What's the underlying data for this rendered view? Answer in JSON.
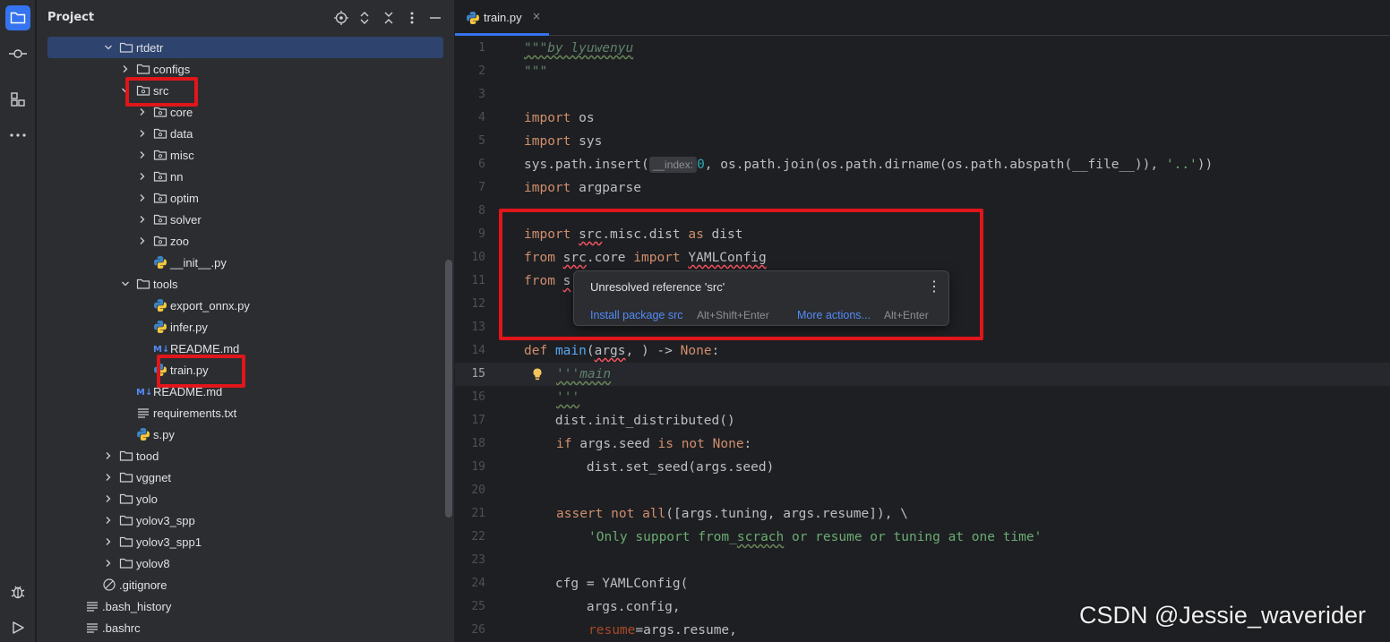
{
  "activity_bar": {
    "icons": [
      "folder-icon",
      "commit-icon",
      "structure-icon",
      "more-icon",
      "debug-icon",
      "run-icon"
    ]
  },
  "project_panel": {
    "title": "Project",
    "header_icons": [
      "locate-icon",
      "expand-all-icon",
      "collapse-all-icon",
      "options-icon",
      "hide-icon"
    ],
    "tree": [
      {
        "label": "rtdetr",
        "type": "folder",
        "expanded": true,
        "selected": true
      },
      {
        "label": "configs",
        "type": "folder",
        "expanded": false
      },
      {
        "label": "src",
        "type": "package",
        "expanded": true
      },
      {
        "label": "core",
        "type": "package",
        "expanded": false
      },
      {
        "label": "data",
        "type": "package",
        "expanded": false
      },
      {
        "label": "misc",
        "type": "package",
        "expanded": false
      },
      {
        "label": "nn",
        "type": "package",
        "expanded": false
      },
      {
        "label": "optim",
        "type": "package",
        "expanded": false
      },
      {
        "label": "solver",
        "type": "package",
        "expanded": false
      },
      {
        "label": "zoo",
        "type": "package",
        "expanded": false
      },
      {
        "label": "__init__.py",
        "type": "python"
      },
      {
        "label": "tools",
        "type": "folder",
        "expanded": true
      },
      {
        "label": "export_onnx.py",
        "type": "python"
      },
      {
        "label": "infer.py",
        "type": "python"
      },
      {
        "label": "README.md",
        "type": "markdown"
      },
      {
        "label": "train.py",
        "type": "python"
      },
      {
        "label": "README.md",
        "type": "markdown"
      },
      {
        "label": "requirements.txt",
        "type": "text"
      },
      {
        "label": "s.py",
        "type": "python"
      },
      {
        "label": "tood",
        "type": "folder",
        "expanded": false
      },
      {
        "label": "vggnet",
        "type": "folder",
        "expanded": false
      },
      {
        "label": "yolo",
        "type": "folder",
        "expanded": false
      },
      {
        "label": "yolov3_spp",
        "type": "folder",
        "expanded": false
      },
      {
        "label": "yolov3_spp1",
        "type": "folder",
        "expanded": false
      },
      {
        "label": "yolov8",
        "type": "folder",
        "expanded": false
      },
      {
        "label": ".gitignore",
        "type": "ignore"
      },
      {
        "label": ".bash_history",
        "type": "text"
      },
      {
        "label": ".bashrc",
        "type": "text"
      }
    ]
  },
  "editor": {
    "tab": {
      "label": "train.py",
      "close": "×"
    },
    "line_numbers": [
      "1",
      "2",
      "3",
      "4",
      "5",
      "6",
      "7",
      "8",
      "9",
      "10",
      "11",
      "12",
      "13",
      "14",
      "15",
      "16",
      "17",
      "18",
      "19",
      "20",
      "21",
      "22",
      "23",
      "24",
      "25",
      "26"
    ],
    "current_line": "15",
    "code": {
      "l1": "\"\"\"by lyuwenyu",
      "l2": "\"\"\"",
      "l4_kw": "import",
      "l4_mod": " os",
      "l5_kw": "import",
      "l5_mod": " sys",
      "l6_a": "sys.path.insert(",
      "l6_hint": "__index:",
      "l6_num": "0",
      "l6_b": ", os.path.join(os.path.dirname(os.path.abspath(__file__)), ",
      "l6_str": "'..'",
      "l6_c": "))",
      "l7_kw": "import",
      "l7_mod": " argparse",
      "l9_kw1": "import",
      "l9_src": "src",
      "l9_mid": ".misc.dist ",
      "l9_kw2": "as",
      "l9_end": " dist",
      "l10_kw1": "from",
      "l10_src": "src",
      "l10_mid": ".core ",
      "l10_kw2": "import",
      "l10_end": "YAMLConfig",
      "l11_kw1": "from",
      "l11_src": "s",
      "l14_kw": "def",
      "l14_fn": "main",
      "l14_a": "(",
      "l14_arg": "args",
      "l14_b": ", ) -> ",
      "l14_none": "None",
      "l14_c": ":",
      "l15": "'''main",
      "l16": "'''",
      "l17": "    dist.init_distributed()",
      "l18_kw1": "if",
      "l18_a": " args.seed ",
      "l18_kw2": "is not",
      "l18_sp": " ",
      "l18_none": "None",
      "l18_b": ":",
      "l19": "        dist.set_seed(args.seed)",
      "l21_kw1": "assert",
      "l21_sp": " ",
      "l21_kw2": "not",
      "l21_sp2": " ",
      "l21_fn": "all",
      "l21_a": "([args.tuning, args.resume]), \\",
      "l22_a": "'Only support from_",
      "l22_b": "scrach",
      "l22_c": " or resume or tuning at one time'",
      "l24": "    cfg = YAMLConfig(",
      "l25": "        args.config,",
      "l26_kw": "resume",
      "l26_a": "=args.resume,"
    }
  },
  "popup": {
    "message": "Unresolved reference 'src'",
    "install_label": "Install package src",
    "install_shortcut": "Alt+Shift+Enter",
    "more_label": "More actions...",
    "more_shortcut": "Alt+Enter",
    "menu": "⋮"
  },
  "watermark": "CSDN @Jessie_waverider",
  "colors": {
    "accent": "#3574f0",
    "annotation": "#e0161b",
    "keyword": "#cf8e6d",
    "string": "#6aab73",
    "function": "#56a8f5"
  }
}
